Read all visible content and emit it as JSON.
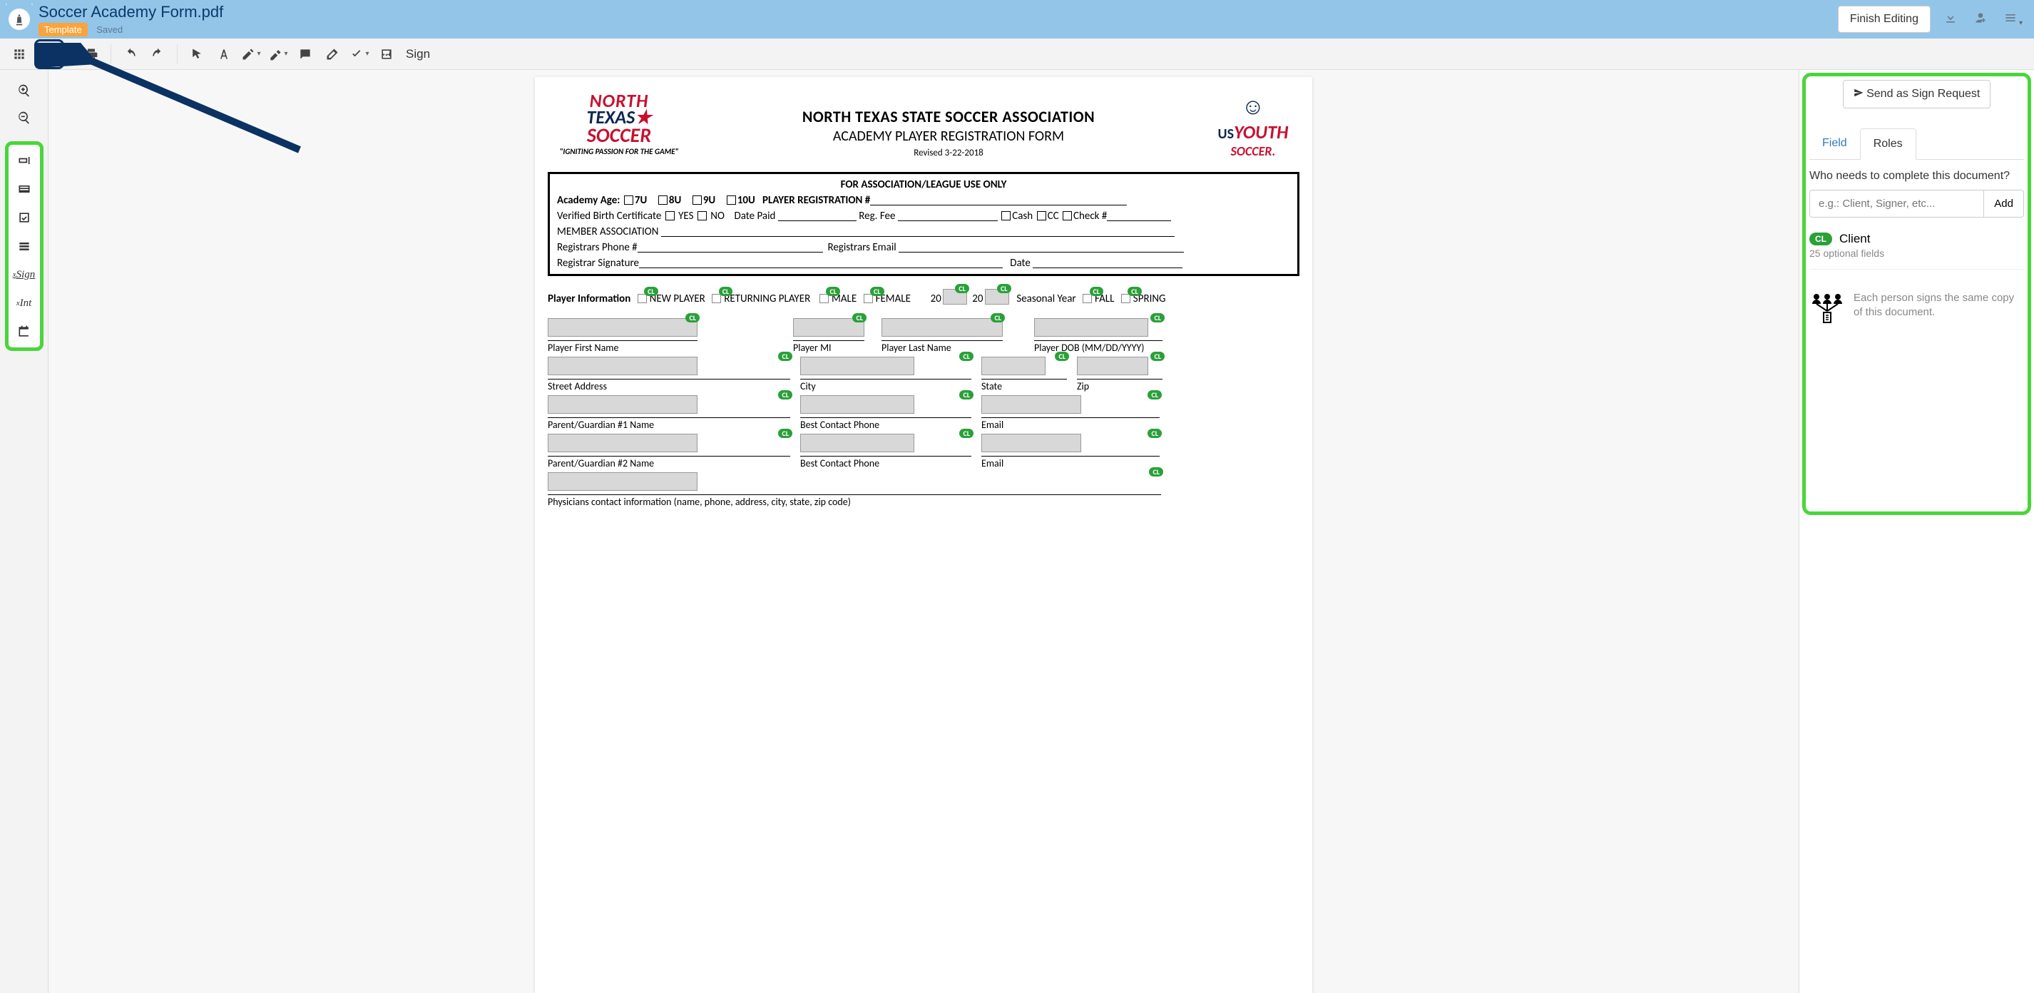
{
  "header": {
    "doc_title": "Soccer Academy Form.pdf",
    "template_badge": "Template",
    "saved": "Saved",
    "finish_editing": "Finish Editing"
  },
  "toolbar": {
    "sign": "Sign"
  },
  "right_panel": {
    "send_request": "Send as Sign Request",
    "tab_field": "Field",
    "tab_roles": "Roles",
    "question": "Who needs to complete this document?",
    "role_placeholder": "e.g.: Client, Signer, etc...",
    "add": "Add",
    "role_badge": "CL",
    "role_name": "Client",
    "role_sub": "25 optional fields",
    "info": "Each person signs the same copy of this document."
  },
  "document": {
    "org_title": "NORTH TEXAS STATE SOCCER ASSOCIATION",
    "form_title": "ACADEMY PLAYER REGISTRATION FORM",
    "revised": "Revised  3-22-2018",
    "logo_north": "NORTH",
    "logo_texas": "TEXAS",
    "logo_soccer": "SOCCER",
    "logo_tag": "\"IGNITING PASSION FOR THE GAME\"",
    "usys_us": "US",
    "usys_youth": "YOUTH",
    "usys_soccer": "SOCCER.",
    "assoc": {
      "title": "FOR ASSOCIATION/LEAGUE USE ONLY",
      "age_label": "Academy Age:",
      "a7u": "7U",
      "a8u": "8U",
      "a9u": "9U",
      "a10u": "10U",
      "reg_num": "PLAYER REGISTRATION #",
      "verified": "Verified Birth Certificate",
      "yes": "YES",
      "no": "NO",
      "date_paid": "Date Paid",
      "reg_fee": "Reg. Fee",
      "cash": "Cash",
      "cc": "CC",
      "check": "Check #",
      "member": "MEMBER ASSOCIATION",
      "reg_phone": "Registrars Phone #",
      "reg_email": "Registrars Email",
      "reg_sig": "Registrar Signature",
      "date": "Date"
    },
    "player_info": {
      "label": "Player Information",
      "new_player": "NEW PLAYER",
      "returning": "RETURNING PLAYER",
      "male": "MALE",
      "female": "FEMALE",
      "yr_prefix1": "20",
      "yr_prefix2": "20",
      "seasonal": "Seasonal Year",
      "fall": "FALL",
      "spring": "SPRING"
    },
    "fields": {
      "first_name": "Player First Name",
      "mi": "Player MI",
      "last_name": "Player Last Name",
      "dob": "Player DOB (MM/DD/YYYY)",
      "street": "Street Address",
      "city": "City",
      "state": "State",
      "zip": "Zip",
      "pg1": "Parent/Guardian #1 Name",
      "phone": "Best Contact Phone",
      "email": "Email",
      "pg2": "Parent/Guardian #2 Name",
      "physician": "Physicians contact information (name, phone, address, city, state, zip code)"
    },
    "cl": "CL"
  }
}
